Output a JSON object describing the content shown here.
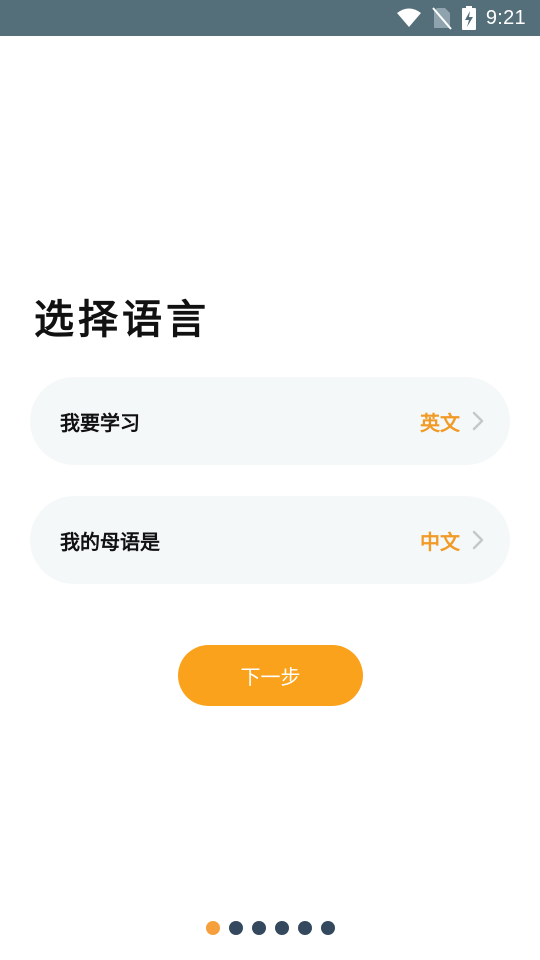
{
  "status_bar": {
    "time": "9:21",
    "icons": [
      "wifi-icon",
      "no-sim-icon",
      "battery-charging-icon"
    ]
  },
  "page": {
    "title": "选择语言"
  },
  "options": [
    {
      "label": "我要学习",
      "value": "英文"
    },
    {
      "label": "我的母语是",
      "value": "中文"
    }
  ],
  "next_button": {
    "label": "下一步"
  },
  "pager": {
    "total": 6,
    "current": 1
  },
  "colors": {
    "status_bar": "#546e7a",
    "accent": "#faa21b",
    "option_value": "#f29a26",
    "card_bg": "#f5f8f9",
    "dot_inactive": "#34495e",
    "dot_active": "#f5a03c"
  }
}
